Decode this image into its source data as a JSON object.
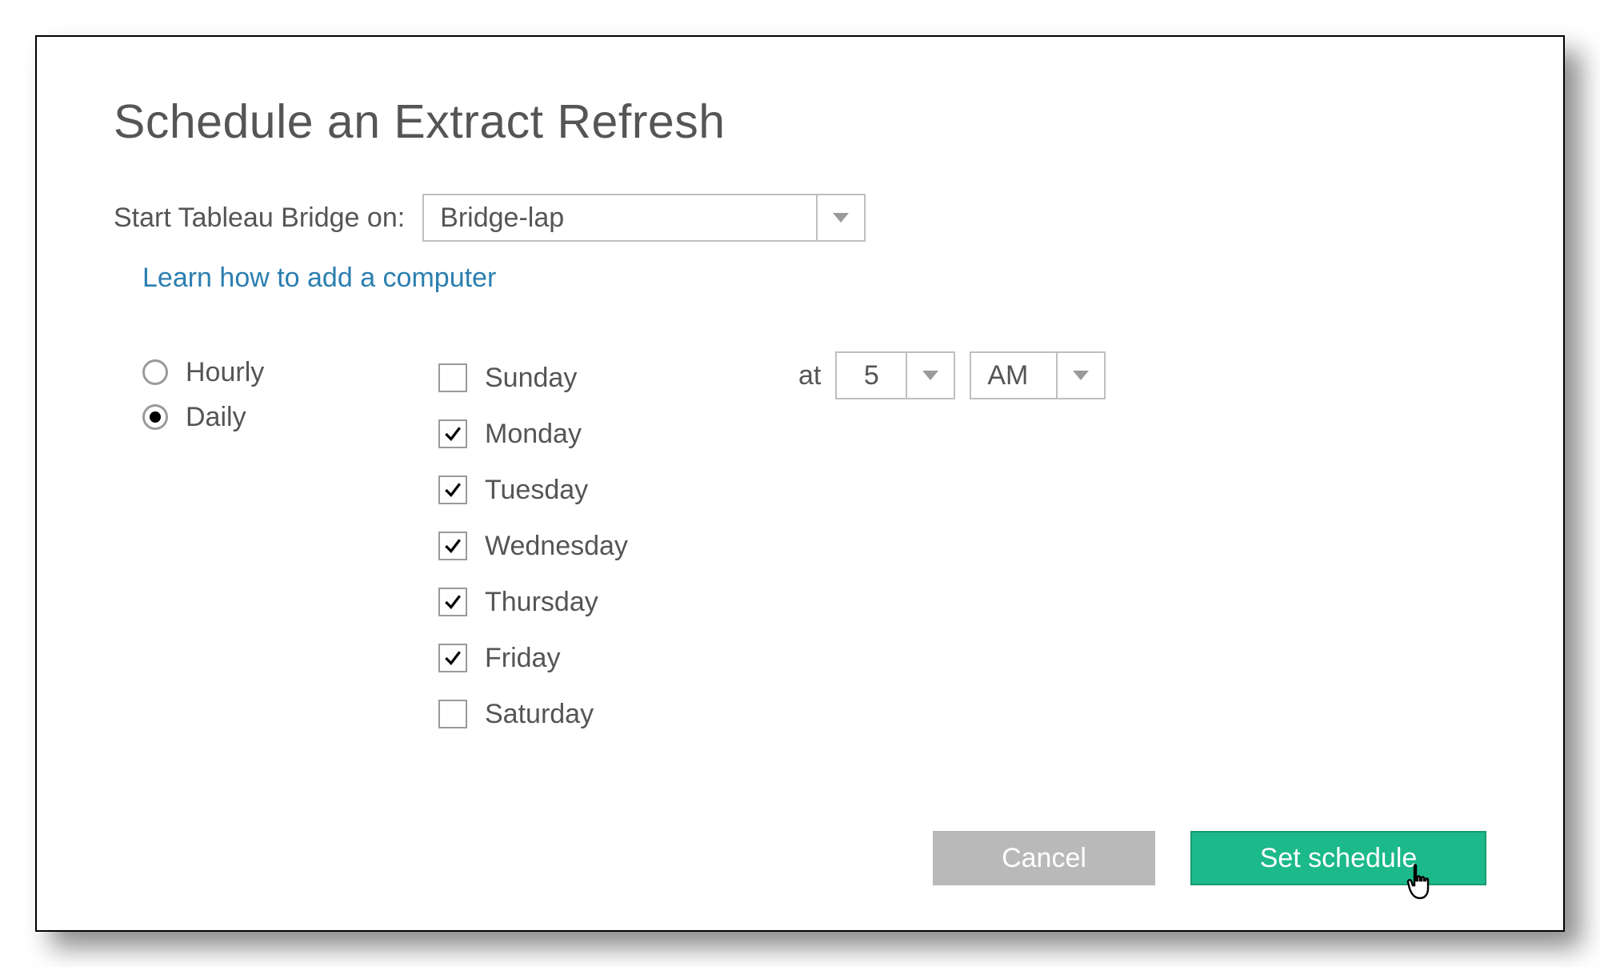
{
  "title": "Schedule an Extract Refresh",
  "bridge": {
    "label": "Start Tableau Bridge on:",
    "selected": "Bridge-lap"
  },
  "link": "Learn how to add a computer",
  "frequency": {
    "options": [
      {
        "label": "Hourly",
        "selected": false
      },
      {
        "label": "Daily",
        "selected": true
      }
    ]
  },
  "days": [
    {
      "label": "Sunday",
      "checked": false
    },
    {
      "label": "Monday",
      "checked": true
    },
    {
      "label": "Tuesday",
      "checked": true
    },
    {
      "label": "Wednesday",
      "checked": true
    },
    {
      "label": "Thursday",
      "checked": true
    },
    {
      "label": "Friday",
      "checked": true
    },
    {
      "label": "Saturday",
      "checked": false
    }
  ],
  "time": {
    "at_label": "at",
    "hour": "5",
    "ampm": "AM"
  },
  "buttons": {
    "cancel": "Cancel",
    "set_schedule": "Set schedule"
  }
}
